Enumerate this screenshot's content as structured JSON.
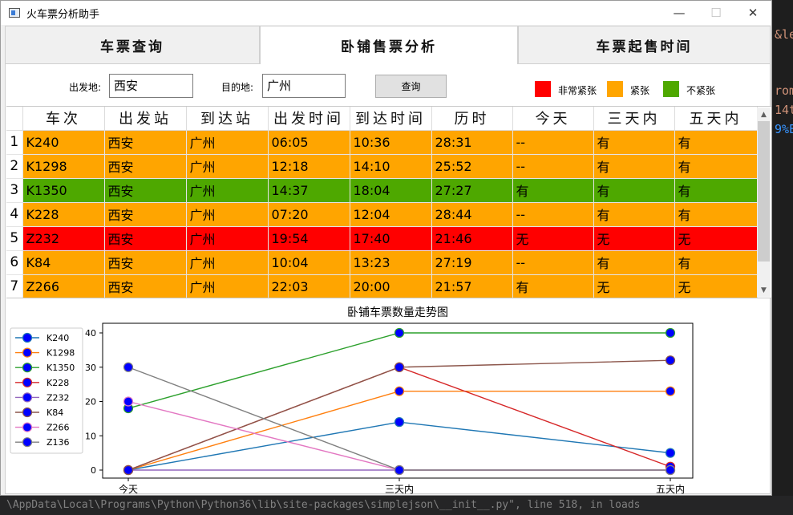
{
  "window": {
    "title": "火车票分析助手",
    "min": "—",
    "max": "☐",
    "close": "✕"
  },
  "tabs": [
    {
      "label": "车票查询",
      "active": false
    },
    {
      "label": "卧铺售票分析",
      "active": true
    },
    {
      "label": "车票起售时间",
      "active": false
    }
  ],
  "query": {
    "from_label": "出发地:",
    "from_value": "西安",
    "to_label": "目的地:",
    "to_value": "广州",
    "button": "查询"
  },
  "legend": [
    {
      "label": "非常紧张",
      "color": "#ff0000"
    },
    {
      "label": "紧张",
      "color": "#ffa500"
    },
    {
      "label": "不紧张",
      "color": "#4ea800"
    }
  ],
  "table": {
    "headers": [
      "车次",
      "出发站",
      "到达站",
      "出发时间",
      "到达时间",
      "历时",
      "今天",
      "三天内",
      "五天内"
    ],
    "rows": [
      {
        "num": "1",
        "color": "#ffa500",
        "cells": [
          "K240",
          "西安",
          "广州",
          "06:05",
          "10:36",
          "28:31",
          "--",
          "有",
          "有"
        ]
      },
      {
        "num": "2",
        "color": "#ffa500",
        "cells": [
          "K1298",
          "西安",
          "广州",
          "12:18",
          "14:10",
          "25:52",
          "--",
          "有",
          "有"
        ]
      },
      {
        "num": "3",
        "color": "#4ea800",
        "cells": [
          "K1350",
          "西安",
          "广州",
          "14:37",
          "18:04",
          "27:27",
          "有",
          "有",
          "有"
        ]
      },
      {
        "num": "4",
        "color": "#ffa500",
        "cells": [
          "K228",
          "西安",
          "广州",
          "07:20",
          "12:04",
          "28:44",
          "--",
          "有",
          "有"
        ]
      },
      {
        "num": "5",
        "color": "#ff0000",
        "cells": [
          "Z232",
          "西安",
          "广州",
          "19:54",
          "17:40",
          "21:46",
          "无",
          "无",
          "无"
        ]
      },
      {
        "num": "6",
        "color": "#ffa500",
        "cells": [
          "K84",
          "西安",
          "广州",
          "10:04",
          "13:23",
          "27:19",
          "--",
          "有",
          "有"
        ]
      },
      {
        "num": "7",
        "color": "#ffa500",
        "cells": [
          "Z266",
          "西安",
          "广州",
          "22:03",
          "20:00",
          "21:57",
          "有",
          "无",
          "无"
        ]
      }
    ]
  },
  "chart_data": {
    "type": "line",
    "title": "卧铺车票数量走势图",
    "categories": [
      "今天",
      "三天内",
      "五天内"
    ],
    "ylim": [
      0,
      40
    ],
    "yticks": [
      0,
      10,
      20,
      30,
      40
    ],
    "grid": false,
    "legend_position": "left",
    "marker": {
      "face": "#0000ff"
    },
    "series": [
      {
        "name": "K240",
        "color": "#1f77b4",
        "values": [
          0,
          14,
          5
        ]
      },
      {
        "name": "K1298",
        "color": "#ff7f0e",
        "values": [
          0,
          23,
          23
        ]
      },
      {
        "name": "K1350",
        "color": "#2ca02c",
        "values": [
          18,
          40,
          40
        ]
      },
      {
        "name": "K228",
        "color": "#d62728",
        "values": [
          0,
          30,
          1
        ]
      },
      {
        "name": "Z232",
        "color": "#9467bd",
        "values": [
          0,
          0,
          0
        ]
      },
      {
        "name": "K84",
        "color": "#8c564b",
        "values": [
          0,
          30,
          32
        ]
      },
      {
        "name": "Z266",
        "color": "#e377c2",
        "values": [
          20,
          0,
          0
        ]
      },
      {
        "name": "Z136",
        "color": "#7f7f7f",
        "values": [
          30,
          0,
          0
        ]
      }
    ]
  },
  "background": {
    "fragments": [
      "&le",
      "rom",
      "14t",
      "9%E"
    ],
    "status": "\\AppData\\Local\\Programs\\Python\\Python36\\lib\\site-packages\\simplejson\\__init__.py\", line 518, in loads"
  }
}
